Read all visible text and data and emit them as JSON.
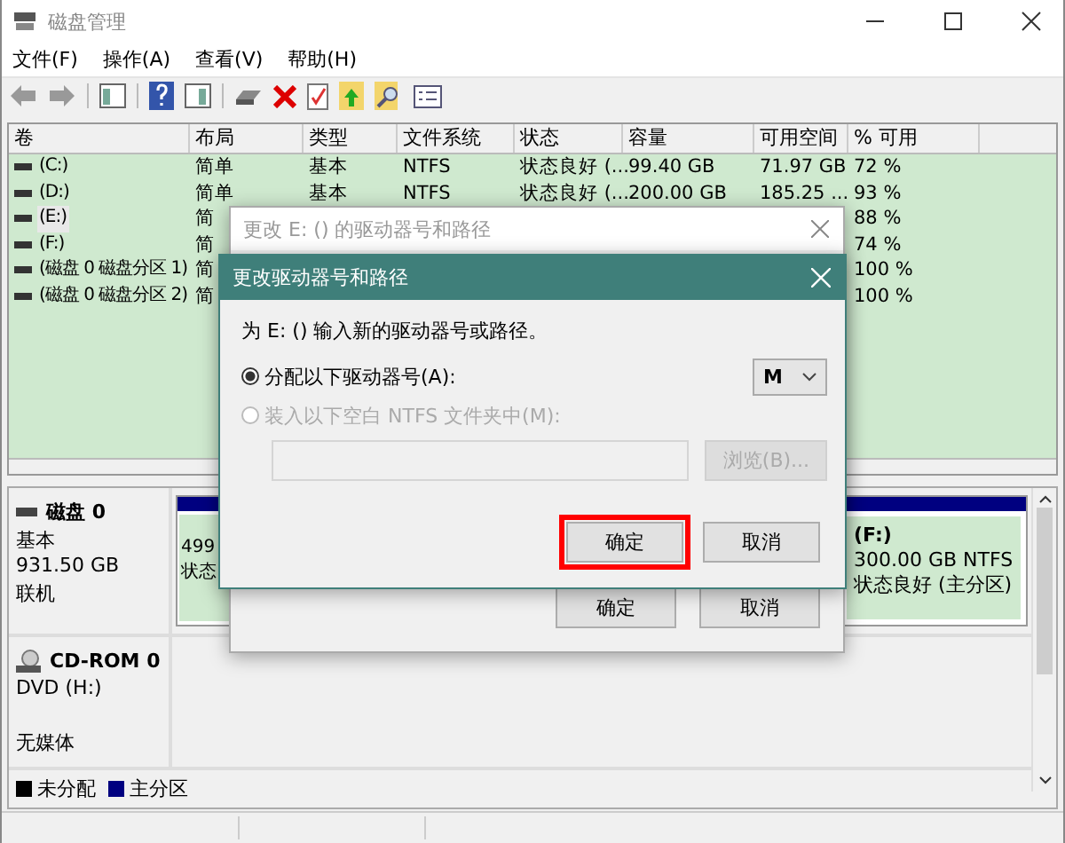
{
  "window": {
    "title": "磁盘管理"
  },
  "menu": [
    "文件(F)",
    "操作(A)",
    "查看(V)",
    "帮助(H)"
  ],
  "volume_table": {
    "columns": [
      "卷",
      "布局",
      "类型",
      "文件系统",
      "状态",
      "容量",
      "可用空间",
      "% 可用"
    ],
    "rows": [
      {
        "selected": false,
        "volume": "(C:)",
        "layout": "简单",
        "type": "基本",
        "fs": "NTFS",
        "status": "状态良好 (...",
        "capacity": "99.40 GB",
        "free": "71.97 GB",
        "percent": "72 %"
      },
      {
        "selected": false,
        "volume": "(D:)",
        "layout": "简单",
        "type": "基本",
        "fs": "NTFS",
        "status": "状态良好 (...",
        "capacity": "200.00 GB",
        "free": "185.25 ...",
        "percent": "93 %"
      },
      {
        "selected": true,
        "volume": "(E:)",
        "layout": "简",
        "percent": "88 %"
      },
      {
        "selected": false,
        "volume": "(F:)",
        "layout": "简",
        "percent": "74 %"
      },
      {
        "selected": false,
        "volume": "(磁盘 0 磁盘分区 1)",
        "layout": "简",
        "percent": "100 %"
      },
      {
        "selected": false,
        "volume": "(磁盘 0 磁盘分区 2)",
        "layout": "简",
        "percent": "100 %"
      }
    ]
  },
  "disks": [
    {
      "kind": "disk",
      "name": "磁盘 0",
      "type": "基本",
      "size": "931.50 GB",
      "status": "联机",
      "partitions": [
        {
          "lines": [
            "499",
            "状态"
          ]
        },
        {
          "lines": [
            "(F:)",
            "300.00 GB NTFS",
            "状态良好 (主分区)"
          ]
        }
      ]
    },
    {
      "kind": "cdrom",
      "name": "CD-ROM 0",
      "type": "DVD (H:)",
      "status": "无媒体"
    }
  ],
  "legend": [
    {
      "label": "未分配",
      "color": "#000000"
    },
    {
      "label": "主分区",
      "color": "#000080"
    }
  ],
  "dialog_back": {
    "title": "更改 E: () 的驱动器号和路径",
    "buttons": [
      "确定",
      "取消"
    ]
  },
  "dialog": {
    "title": "更改驱动器号和路径",
    "prompt": "为 E: () 输入新的驱动器号或路径。",
    "options": [
      {
        "kind": "letter",
        "label": "分配以下驱动器号(A):",
        "selected": true,
        "disabled": false,
        "value": "M"
      },
      {
        "kind": "folder",
        "label": "装入以下空白 NTFS 文件夹中(M):",
        "selected": false,
        "disabled": true,
        "browse": "浏览(B)..."
      }
    ],
    "buttons": [
      {
        "label": "确定",
        "highlighted": true
      },
      {
        "label": "取消",
        "highlighted": false
      }
    ]
  }
}
